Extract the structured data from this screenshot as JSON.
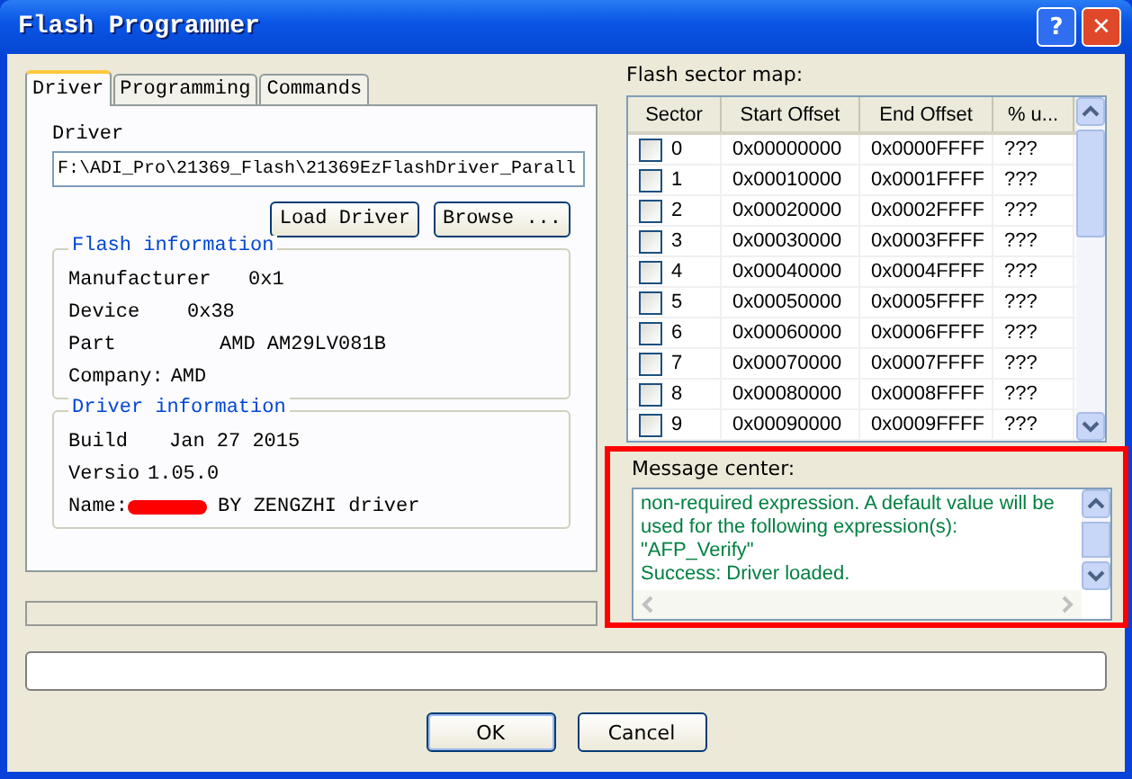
{
  "window": {
    "title": "Flash Programmer",
    "title_buttons": [
      "?",
      "✕"
    ]
  },
  "tabs": [
    {
      "label": "Driver",
      "selected": true
    },
    {
      "label": "Programming",
      "selected": false
    },
    {
      "label": "Commands",
      "selected": false
    }
  ],
  "driver": {
    "label": "Driver",
    "path": "F:\\ADI_Pro\\21369_Flash\\21369EzFlashDriver_Parall",
    "buttons": [
      "Load Driver",
      "Browse ..."
    ]
  },
  "flash_information": {
    "title": "Flash information",
    "rows": [
      {
        "label": "Manufacturer",
        "value": "0x1"
      },
      {
        "label": "Device",
        "value": "0x38"
      },
      {
        "label": "Part",
        "value": "AMD AM29LV081B"
      },
      {
        "label": "Company:",
        "value": "AMD"
      }
    ]
  },
  "driver_information": {
    "title": "Driver information",
    "build_label": "Build",
    "build_value": "Jan 27 2015",
    "version_label": "Versio",
    "version_value": "1.05.0",
    "name_label": "Name:",
    "name_value": "BY ZENGZHI driver"
  },
  "progress": {
    "level": 0
  },
  "sector_map": {
    "label": "Flash sector map:",
    "columns": [
      "Sector",
      "Start Offset",
      "End Offset",
      "% u..."
    ],
    "rows": [
      {
        "sector": "0",
        "start": "0x00000000",
        "end": "0x0000FFFF",
        "used": "???",
        "checked": false
      },
      {
        "sector": "1",
        "start": "0x00010000",
        "end": "0x0001FFFF",
        "used": "???",
        "checked": false
      },
      {
        "sector": "2",
        "start": "0x00020000",
        "end": "0x0002FFFF",
        "used": "???",
        "checked": false
      },
      {
        "sector": "3",
        "start": "0x00030000",
        "end": "0x0003FFFF",
        "used": "???",
        "checked": false
      },
      {
        "sector": "4",
        "start": "0x00040000",
        "end": "0x0004FFFF",
        "used": "???",
        "checked": false
      },
      {
        "sector": "5",
        "start": "0x00050000",
        "end": "0x0005FFFF",
        "used": "???",
        "checked": false
      },
      {
        "sector": "6",
        "start": "0x00060000",
        "end": "0x0006FFFF",
        "used": "???",
        "checked": false
      },
      {
        "sector": "7",
        "start": "0x00070000",
        "end": "0x0007FFFF",
        "used": "???",
        "checked": false
      },
      {
        "sector": "8",
        "start": "0x00080000",
        "end": "0x0008FFFF",
        "used": "???",
        "checked": false
      },
      {
        "sector": "9",
        "start": "0x00090000",
        "end": "0x0009FFFF",
        "used": "???",
        "checked": false
      }
    ]
  },
  "message_center": {
    "label": "Message center:",
    "lines": [
      "non-required expression.  A default value will be",
      "used for the following expression(s):",
      "\"AFP_Verify\"",
      "Success: Driver loaded."
    ]
  },
  "buttons": [
    "OK",
    "Cancel"
  ]
}
